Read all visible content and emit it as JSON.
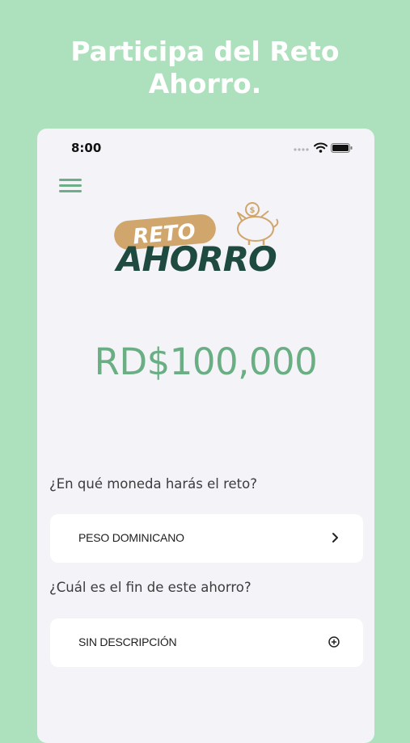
{
  "promo": {
    "line1": "Participa del Reto",
    "line2": "Ahorro."
  },
  "status_bar": {
    "time": "8:00"
  },
  "logo": {
    "word1": "RETO",
    "word2": "AHORRO"
  },
  "challenge": {
    "amount": "RD$100,000"
  },
  "form": {
    "currency_question": "¿En qué moneda harás el reto?",
    "currency_value": "PESO DOMINICANO",
    "purpose_question": "¿Cuál es el fin de este ahorro?",
    "purpose_value": "SIN DESCRIPCIÓN"
  },
  "colors": {
    "background": "#ade0bc",
    "accent_green": "#6aae84",
    "logo_dark": "#1f4a3f",
    "logo_tan": "#d0a66c"
  },
  "icons": {
    "menu": "hamburger-icon",
    "currency_action": "chevron-right-icon",
    "purpose_action": "add-circle-icon"
  }
}
